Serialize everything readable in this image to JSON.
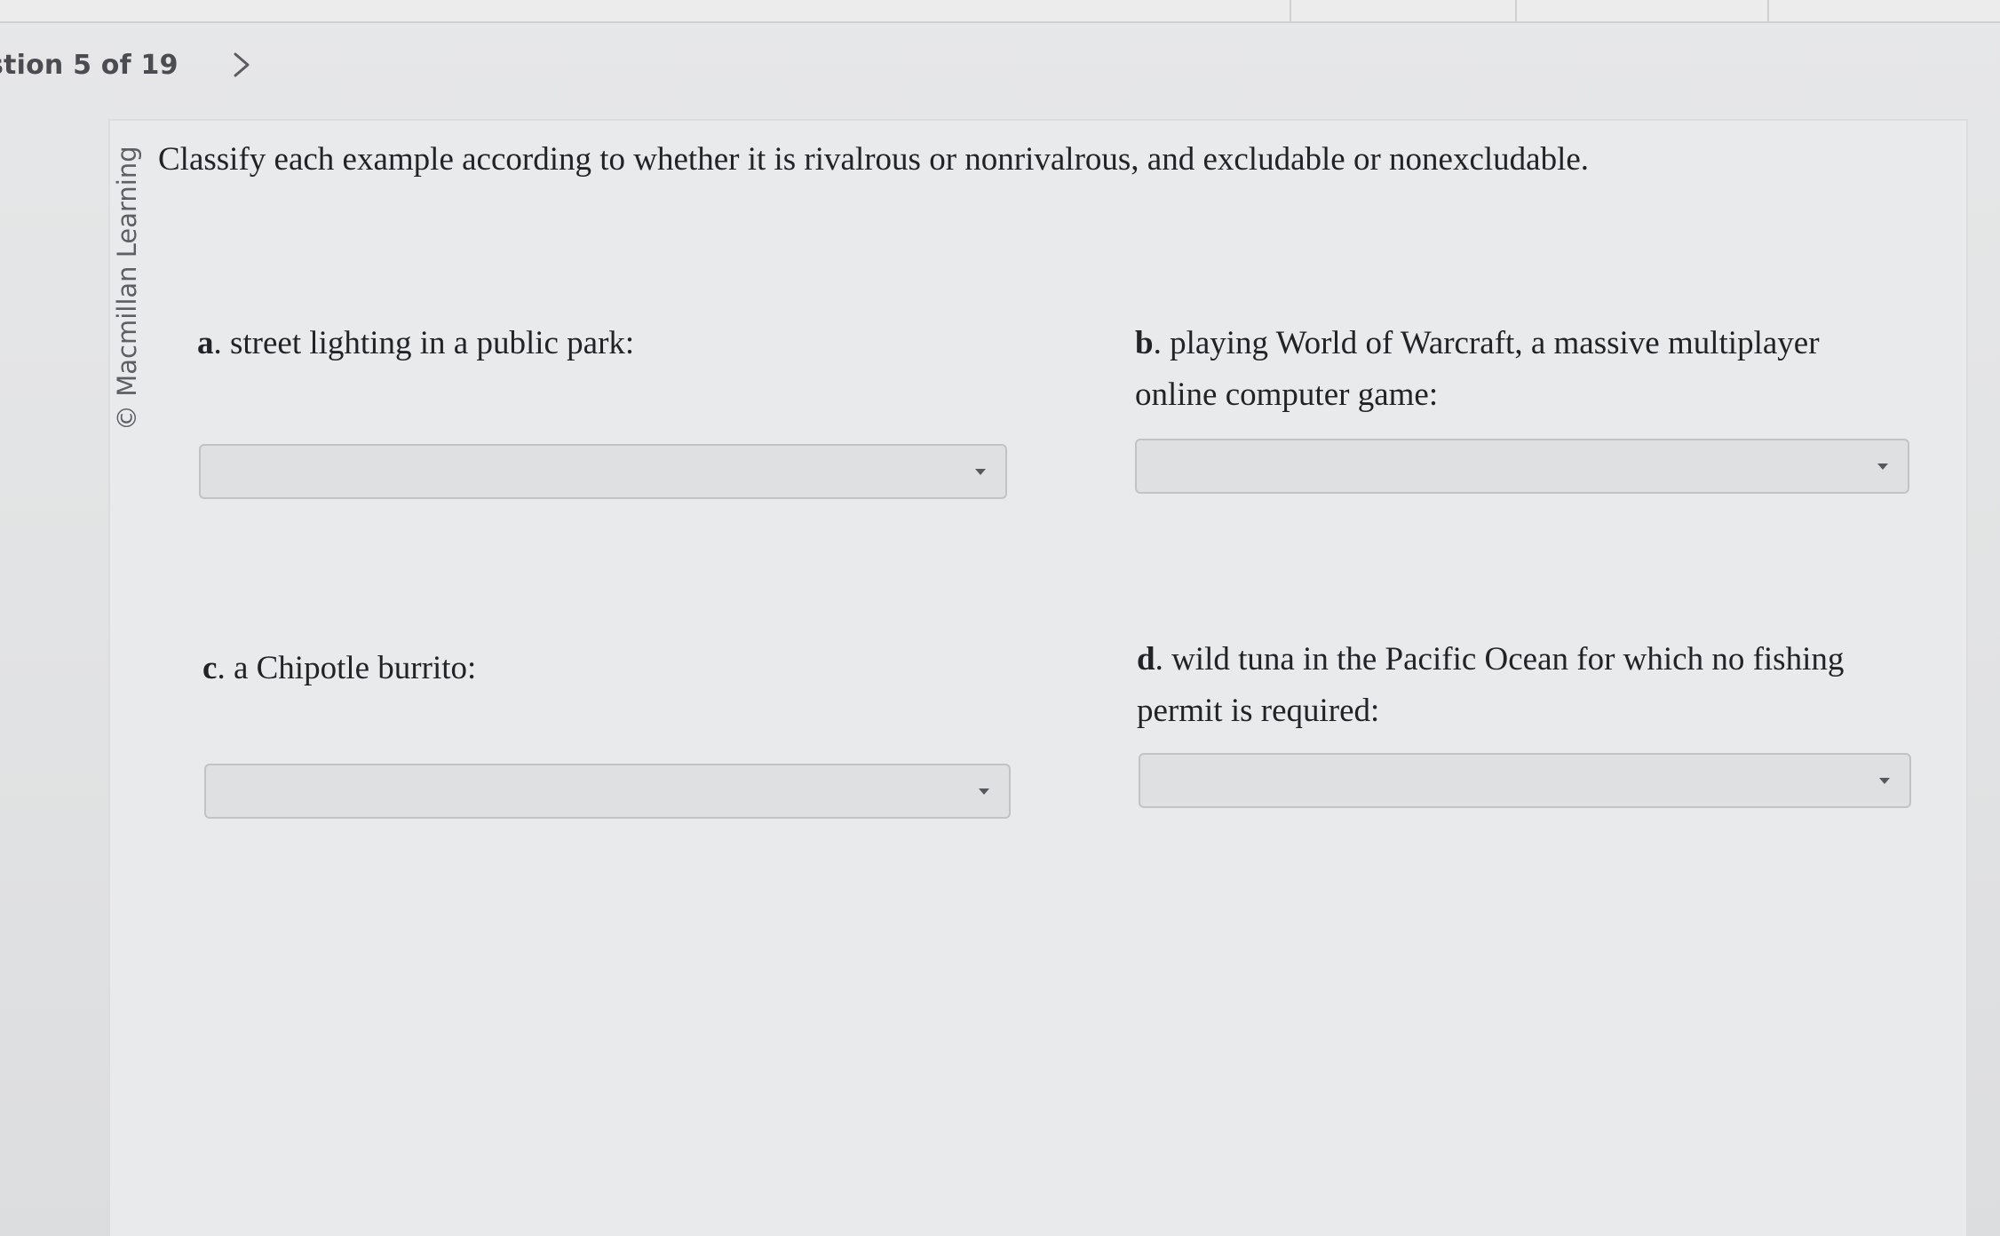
{
  "nav": {
    "question_count": "stion 5 of 19",
    "next_icon": "chevron-right-icon"
  },
  "copyright": "© Macmillan Learning",
  "prompt": "Classify each example according to whether it is rivalrous or nonrivalrous, and excludable or nonexcludable.",
  "items": [
    {
      "letter": "a",
      "text": "street lighting in a public park:",
      "selected": ""
    },
    {
      "letter": "b",
      "text": "playing World of Warcraft, a massive multiplayer online computer game:",
      "selected": ""
    },
    {
      "letter": "c",
      "text": "a Chipotle burrito:",
      "selected": ""
    },
    {
      "letter": "d",
      "text": "wild tuna in the Pacific Ocean for which no fishing permit is required:",
      "selected": ""
    }
  ]
}
